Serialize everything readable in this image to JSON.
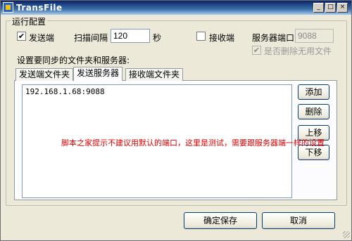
{
  "window": {
    "title": "TransFile",
    "minimize_label": "_",
    "maximize_label": "□",
    "close_label": "×"
  },
  "config": {
    "group_label": "运行配置",
    "send_checkbox": {
      "checked": true,
      "label": "发送端"
    },
    "scan_interval_label": "扫描间隔",
    "scan_interval_value": "120",
    "seconds_label": "秒",
    "receive_checkbox": {
      "checked": false,
      "label": "接收端"
    },
    "server_port_label": "服务器端口",
    "server_port_value": "9088",
    "delete_unused_checkbox": {
      "checked": true,
      "disabled": true,
      "label": "是否删除无用文件"
    },
    "sync_label": "设置要同步的文件夹和服务器:"
  },
  "tabs": [
    {
      "label": "发送端文件夹",
      "active": false
    },
    {
      "label": "发送服务器",
      "active": true
    },
    {
      "label": "接收端文件夹",
      "active": false
    }
  ],
  "server_list": {
    "items": [
      "192.168.1.68:9088"
    ]
  },
  "side_buttons": {
    "add": "添加",
    "delete": "删除",
    "move_up": "上移",
    "move_down": "下移"
  },
  "overlay_text": "脚本之家提示不建议用默认的端口，这里是测试，需要跟服务器端一样的设置",
  "footer": {
    "save": "确定保存",
    "cancel": "取消"
  },
  "colors": {
    "titlebar": "#0a246a",
    "overlay_text": "#e00000",
    "background": "#ece9d8"
  }
}
